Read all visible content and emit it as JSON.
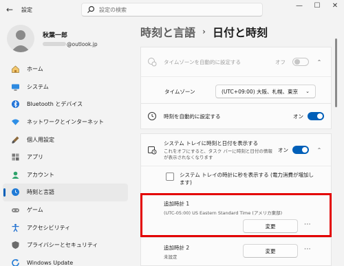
{
  "titlebar": {
    "back_glyph": "←",
    "title": "設定",
    "search_placeholder": "設定の検索",
    "minimize": "—",
    "maximize": "☐",
    "close": "✕"
  },
  "profile": {
    "name": "秋葉一郎",
    "email_suffix": "@outlook.jp"
  },
  "nav": [
    {
      "label": "ホーム",
      "icon": "home-icon"
    },
    {
      "label": "システム",
      "icon": "system-icon"
    },
    {
      "label": "Bluetooth とデバイス",
      "icon": "bluetooth-icon"
    },
    {
      "label": "ネットワークとインターネット",
      "icon": "network-icon"
    },
    {
      "label": "個人用設定",
      "icon": "personalization-icon"
    },
    {
      "label": "アプリ",
      "icon": "apps-icon"
    },
    {
      "label": "アカウント",
      "icon": "accounts-icon"
    },
    {
      "label": "時刻と言語",
      "icon": "time-language-icon",
      "active": true
    },
    {
      "label": "ゲーム",
      "icon": "gaming-icon"
    },
    {
      "label": "アクセシビリティ",
      "icon": "accessibility-icon"
    },
    {
      "label": "プライバシーとセキュリティ",
      "icon": "privacy-icon"
    },
    {
      "label": "Windows Update",
      "icon": "windows-update-icon"
    }
  ],
  "breadcrumb": {
    "parent": "時刻と言語",
    "separator": "›",
    "current": "日付と時刻"
  },
  "settings": {
    "auto_timezone": {
      "label": "タイムゾーンを自動的に設定する",
      "state": "オフ"
    },
    "timezone": {
      "label": "タイムゾーン",
      "value": "(UTC+09:00) 大阪、札幌、東京"
    },
    "auto_time": {
      "label": "時刻を自動的に設定する",
      "state": "オン"
    },
    "tray": {
      "label": "システム トレイに時刻と日付を表示する",
      "desc": "これをオフにすると、タスク バーに時刻と日付の情報が表示されなくなります",
      "state": "オン"
    },
    "seconds": {
      "label": "システム トレイの時計に秒を表示する (電力消費が増加します)"
    },
    "clock1": {
      "title": "追加時計 1",
      "sub": "(UTC-05:00) US Eastern Standard Time (アメリカ東部)",
      "button": "変更",
      "more": "···"
    },
    "clock2": {
      "title": "追加時計 2",
      "sub": "未設定",
      "button": "変更",
      "more": "···"
    }
  },
  "colors": {
    "accent": "#005fb8",
    "highlight_border": "#e30000"
  }
}
